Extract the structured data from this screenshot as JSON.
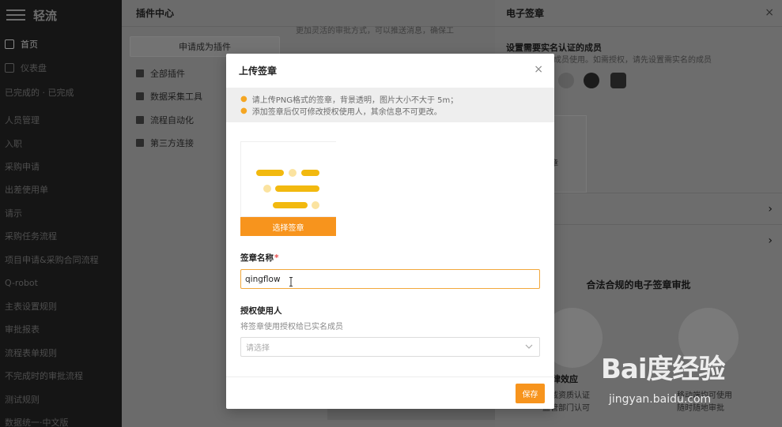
{
  "sidebar": {
    "logo": "轻流",
    "items": [
      {
        "label": "首页",
        "active": true
      },
      {
        "label": "仪表盘"
      },
      {
        "label": "已完成的 · 已完成"
      },
      {
        "label": "人员管理"
      },
      {
        "label": "入职"
      },
      {
        "label": "采购申请"
      },
      {
        "label": "出差使用单"
      },
      {
        "label": "请示"
      },
      {
        "label": "采购任务流程"
      },
      {
        "label": "项目申请&采购合同流程"
      },
      {
        "label": "Q-robot"
      },
      {
        "label": "主表设置规则"
      },
      {
        "label": "审批报表"
      },
      {
        "label": "流程表单规则"
      },
      {
        "label": "不完成时的审批流程"
      },
      {
        "label": "测试规则"
      },
      {
        "label": "数据统一·中文版"
      }
    ]
  },
  "plugin_center": {
    "title": "插件中心",
    "apply_label": "申请成为插件",
    "categories": [
      {
        "label": "全部插件"
      },
      {
        "label": "数据采集工具"
      },
      {
        "label": "流程自动化"
      },
      {
        "label": "第三方连接"
      }
    ],
    "content_snippet": "更加灵活的审批方式，可以推送消息，确保工"
  },
  "esign": {
    "title": "电子签章",
    "close": "×",
    "members_title": "设置需要实名认证的成员",
    "members_desc": "授权给已实名成员使用。如需授权，请先设置需实名的成员",
    "seal_label": "章",
    "promo_title": "合法合规的电子签章审批",
    "promo_left_title": "有法律效应",
    "promo_left_1": "权威资质认证",
    "promo_left_2": "监管部门认可",
    "promo_right_1": "移动端均可使用",
    "promo_right_2": "随时随地审批"
  },
  "modal": {
    "title": "上传签章",
    "close": "×",
    "notices": [
      "请上传PNG格式的签章，背景透明，图片大小不大于 5m；",
      "添加签章后仅可修改授权使用人，其余信息不可更改。"
    ],
    "pick_label": "选择签章",
    "name_label": "签章名称",
    "required_mark": "*",
    "name_value": "qingflow",
    "auth_label": "授权使用人",
    "auth_hint": "将签章使用授权给已实名成员",
    "select_placeholder": "请选择",
    "save_label": "保存"
  },
  "watermark": {
    "brand": "Bai度经验",
    "site": "jingyan.baidu.com"
  },
  "colors": {
    "accent": "#f7941d",
    "seal_gold": "#f2b90f",
    "required": "#e94f4f"
  }
}
